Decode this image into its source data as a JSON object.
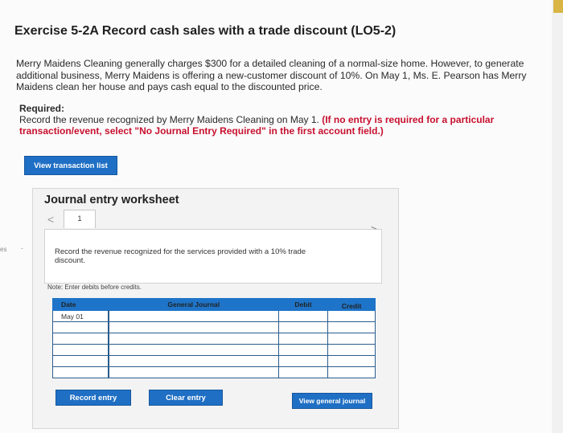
{
  "exercise": {
    "title": "Exercise 5-2A Record cash sales with a trade discount (LO5-2)",
    "intro": "Merry Maidens Cleaning generally charges $300 for a detailed cleaning of a normal-size home. However, to generate additional business, Merry Maidens is offering a new-customer discount of 10%. On May 1, Ms. E. Pearson has Merry Maidens clean her house and pays cash equal to the discounted price.",
    "required_heading": "Required:",
    "required_text": "Record the revenue recognized by Merry Maidens Cleaning on May 1. ",
    "required_strong": "(If no entry is required for a particular transaction/event, select \"No Journal Entry Required\" in the first account field.)"
  },
  "buttons": {
    "view_transaction_list": "View transaction list",
    "record_entry": "Record entry",
    "clear_entry": "Clear entry",
    "view_general_journal": "View general journal"
  },
  "worksheet": {
    "title": "Journal entry worksheet",
    "prev_symbol": "<",
    "next_symbol": ">",
    "current_tab": "1",
    "description": "Record the revenue recognized for the services provided with a 10% trade discount.",
    "note": "Note: Enter debits before credits."
  },
  "journal_table": {
    "headers": {
      "date": "Date",
      "account": "General Journal",
      "debit": "Debit",
      "credit": "Credit"
    },
    "rows": [
      {
        "date": "May 01",
        "account": "",
        "debit": "",
        "credit": ""
      },
      {
        "date": "",
        "account": "",
        "debit": "",
        "credit": ""
      },
      {
        "date": "",
        "account": "",
        "debit": "",
        "credit": ""
      },
      {
        "date": "",
        "account": "",
        "debit": "",
        "credit": ""
      },
      {
        "date": "",
        "account": "",
        "debit": "",
        "credit": ""
      },
      {
        "date": "",
        "account": "",
        "debit": "",
        "credit": ""
      }
    ]
  },
  "margin": {
    "scrap_text": "es",
    "dash": "-"
  },
  "colors": {
    "button_blue": "#1f6fc4",
    "header_blue": "#1e74c8",
    "highlight_red": "#c8102e"
  }
}
